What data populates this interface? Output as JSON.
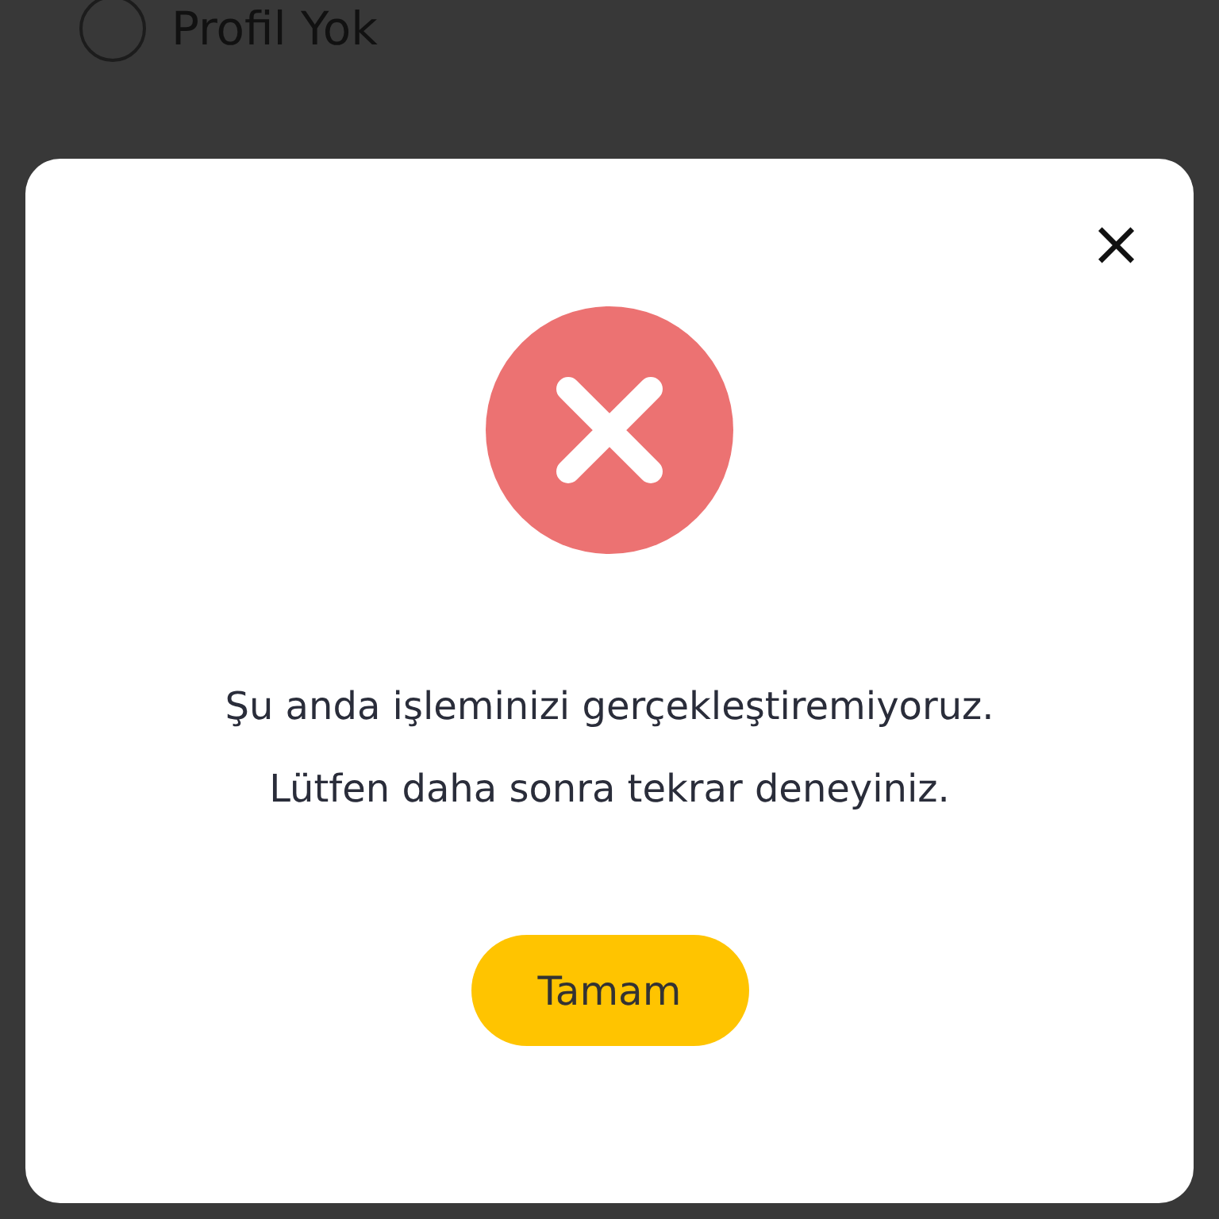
{
  "background_options": [
    {
      "label": "Profil Yok",
      "selected": false
    }
  ],
  "dialog": {
    "close": "×",
    "message_lines": [
      "Şu anda işleminizi gerçekleştiremiyoruz.",
      "Lütfen daha sonra tekrar deneyiniz."
    ],
    "button": "Tamam"
  }
}
